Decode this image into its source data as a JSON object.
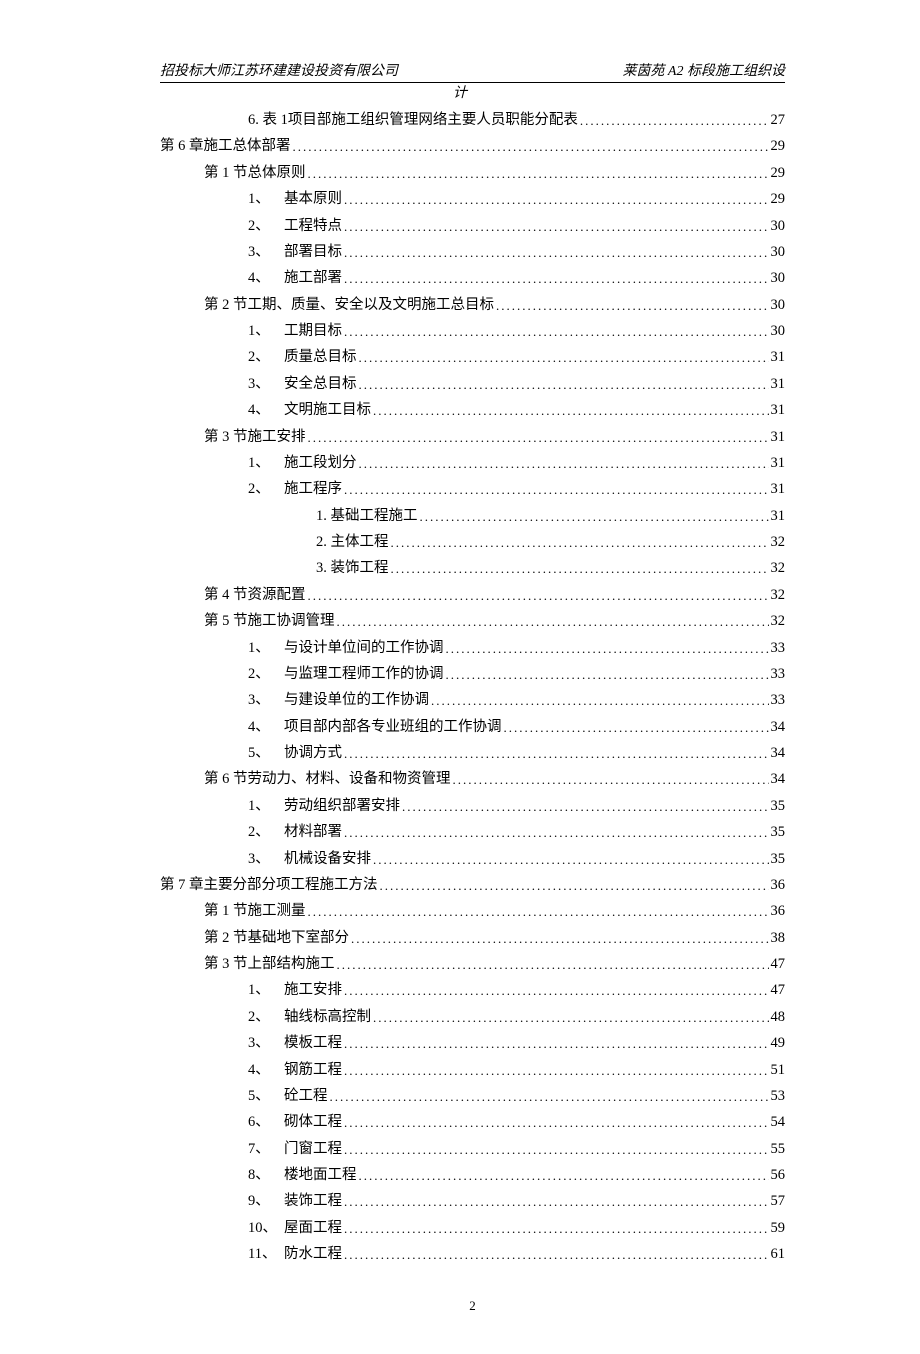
{
  "header_left": "招投标大师江苏环建建设投资有限公司",
  "header_right": "莱茵苑 A2 标段施工组织设",
  "header_center": "计",
  "footer_page": "2",
  "toc": [
    {
      "indent": "indent-2",
      "num": "6. 表 1 ",
      "label": "项目部施工组织管理网络主要人员职能分配表",
      "page": "27"
    },
    {
      "indent": "indent-0",
      "num": "第 6 章 ",
      "label": "施工总体部署",
      "page": "29"
    },
    {
      "indent": "indent-1",
      "num": "第 1 节 ",
      "label": "总体原则",
      "page": "29"
    },
    {
      "indent": "indent-2",
      "num": "1、 ",
      "label": "基本原则",
      "page": "29"
    },
    {
      "indent": "indent-2",
      "num": "2、 ",
      "label": "工程特点",
      "page": "30"
    },
    {
      "indent": "indent-2",
      "num": "3、 ",
      "label": "部署目标",
      "page": "30"
    },
    {
      "indent": "indent-2",
      "num": "4、 ",
      "label": "施工部署",
      "page": "30"
    },
    {
      "indent": "indent-1",
      "num": "第 2 节 ",
      "label": "工期、质量、安全以及文明施工总目标",
      "page": "30"
    },
    {
      "indent": "indent-2",
      "num": "1、 ",
      "label": "工期目标",
      "page": "30"
    },
    {
      "indent": "indent-2",
      "num": "2、 ",
      "label": "质量总目标",
      "page": "31"
    },
    {
      "indent": "indent-2",
      "num": "3、 ",
      "label": "安全总目标",
      "page": "31"
    },
    {
      "indent": "indent-2",
      "num": "4、 ",
      "label": "文明施工目标",
      "page": " 31"
    },
    {
      "indent": "indent-1",
      "num": "第 3 节 ",
      "label": "施工安排",
      "page": "31"
    },
    {
      "indent": "indent-2",
      "num": "1、 ",
      "label": "施工段划分",
      "page": "31"
    },
    {
      "indent": "indent-2",
      "num": "2、 ",
      "label": "施工程序",
      "page": "31"
    },
    {
      "indent": "indent-3",
      "num": "",
      "label": "1. 基础工程施工",
      "page": " 31"
    },
    {
      "indent": "indent-3",
      "num": "",
      "label": "2. 主体工程",
      "page": "32"
    },
    {
      "indent": "indent-3",
      "num": "",
      "label": "3. 装饰工程",
      "page": "32"
    },
    {
      "indent": "indent-1",
      "num": "第 4 节 ",
      "label": "资源配置",
      "page": "32"
    },
    {
      "indent": "indent-1",
      "num": "第 5 节 ",
      "label": "施工协调管理",
      "page": "32"
    },
    {
      "indent": "indent-2",
      "num": "1、 ",
      "label": "与设计单位间的工作协调",
      "page": " 33"
    },
    {
      "indent": "indent-2",
      "num": "2、 ",
      "label": "与监理工程师工作的协调",
      "page": " 33"
    },
    {
      "indent": "indent-2",
      "num": "3、 ",
      "label": "与建设单位的工作协调",
      "page": " 33"
    },
    {
      "indent": "indent-2",
      "num": "4、 ",
      "label": "项目部内部各专业班组的工作协调",
      "page": " 34"
    },
    {
      "indent": "indent-2",
      "num": "5、 ",
      "label": "协调方式",
      "page": "34"
    },
    {
      "indent": "indent-1",
      "num": "第 6 节 ",
      "label": "劳动力、材料、设备和物资管理",
      "page": " 34"
    },
    {
      "indent": "indent-2",
      "num": "1、 ",
      "label": "劳动组织部署安排",
      "page": " 35"
    },
    {
      "indent": "indent-2",
      "num": "2、 ",
      "label": "材料部署",
      "page": "35"
    },
    {
      "indent": "indent-2",
      "num": "3、 ",
      "label": "机械设备安排",
      "page": " 35"
    },
    {
      "indent": "indent-0",
      "num": "第 7 章 ",
      "label": "主要分部分项工程施工方法",
      "page": " 36"
    },
    {
      "indent": "indent-1",
      "num": "第 1 节 ",
      "label": "施工测量",
      "page": "36"
    },
    {
      "indent": "indent-1",
      "num": "第 2 节 ",
      "label": "基础地下室部分",
      "page": " 38"
    },
    {
      "indent": "indent-1",
      "num": "第 3 节 ",
      "label": "上部结构施工",
      "page": "47"
    },
    {
      "indent": "indent-2",
      "num": "1、 ",
      "label": "施工安排",
      "page": "47"
    },
    {
      "indent": "indent-2",
      "num": "2、 ",
      "label": "轴线标高控制",
      "page": " 48"
    },
    {
      "indent": "indent-2",
      "num": "3、 ",
      "label": "模板工程",
      "page": "49"
    },
    {
      "indent": "indent-2",
      "num": "4、 ",
      "label": "钢筋工程",
      "page": "51"
    },
    {
      "indent": "indent-2",
      "num": "5、 ",
      "label": "砼工程",
      "page": "53"
    },
    {
      "indent": "indent-2",
      "num": "6、 ",
      "label": "砌体工程",
      "page": "54"
    },
    {
      "indent": "indent-2",
      "num": "7、 ",
      "label": "门窗工程",
      "page": "55"
    },
    {
      "indent": "indent-2",
      "num": "8、 ",
      "label": "楼地面工程",
      "page": "56"
    },
    {
      "indent": "indent-2",
      "num": "9、 ",
      "label": "装饰工程",
      "page": "57"
    },
    {
      "indent": "indent-3b",
      "num": "10、 ",
      "label": "屋面工程",
      "page": "59"
    },
    {
      "indent": "indent-3b",
      "num": "11、 ",
      "label": "防水工程",
      "page": "61"
    }
  ]
}
